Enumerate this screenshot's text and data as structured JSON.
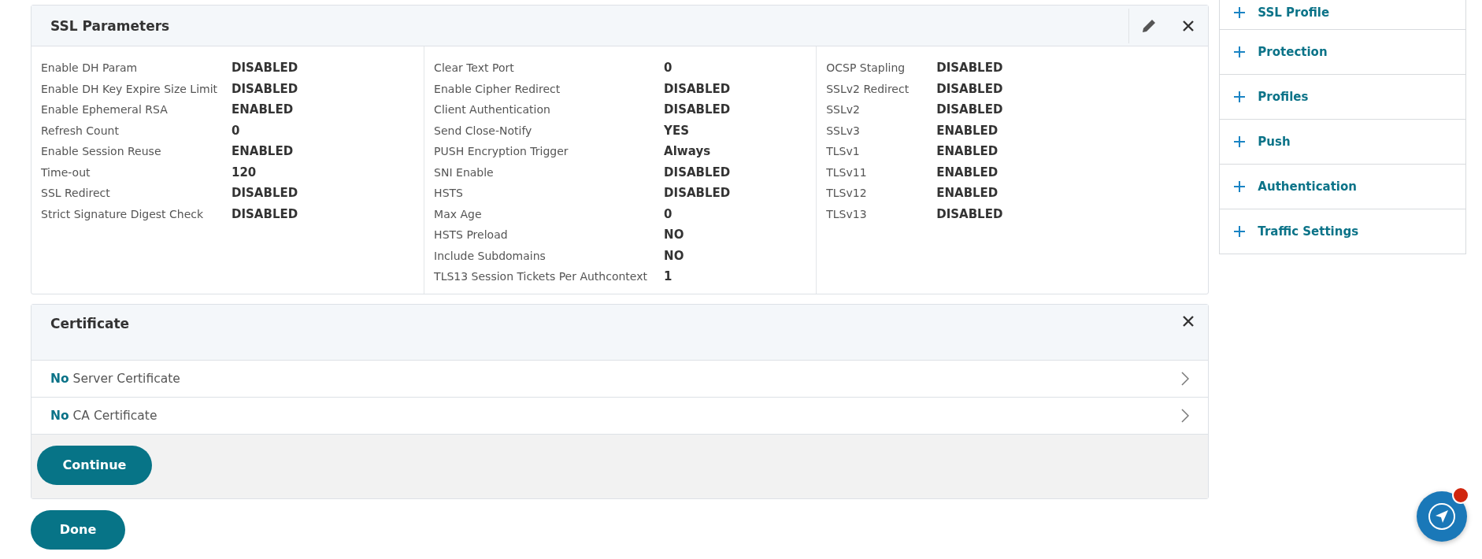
{
  "ssl_parameters": {
    "title": "SSL Parameters",
    "columns": [
      {
        "rows": [
          {
            "label": "Enable DH Param",
            "value": "DISABLED"
          },
          {
            "label": "Enable DH Key Expire Size Limit",
            "value": "DISABLED"
          },
          {
            "label": "Enable Ephemeral RSA",
            "value": "ENABLED"
          },
          {
            "label": "Refresh Count",
            "value": "0"
          },
          {
            "label": "Enable Session Reuse",
            "value": "ENABLED"
          },
          {
            "label": "Time-out",
            "value": "120"
          },
          {
            "label": "SSL Redirect",
            "value": "DISABLED"
          },
          {
            "label": "Strict Signature Digest Check",
            "value": "DISABLED"
          }
        ]
      },
      {
        "rows": [
          {
            "label": "Clear Text Port",
            "value": "0"
          },
          {
            "label": "Enable Cipher Redirect",
            "value": "DISABLED"
          },
          {
            "label": "Client Authentication",
            "value": "DISABLED"
          },
          {
            "label": "Send Close-Notify",
            "value": "YES"
          },
          {
            "label": "PUSH Encryption Trigger",
            "value": "Always"
          },
          {
            "label": "SNI Enable",
            "value": "DISABLED"
          },
          {
            "label": "HSTS",
            "value": "DISABLED"
          },
          {
            "label": "Max Age",
            "value": "0"
          },
          {
            "label": "HSTS Preload",
            "value": "NO"
          },
          {
            "label": "Include Subdomains",
            "value": "NO"
          },
          {
            "label": "TLS13 Session Tickets Per Authcontext",
            "value": "1"
          }
        ]
      },
      {
        "rows": [
          {
            "label": "OCSP Stapling",
            "value": "DISABLED"
          },
          {
            "label": "SSLv2 Redirect",
            "value": "DISABLED"
          },
          {
            "label": "SSLv2",
            "value": "DISABLED"
          },
          {
            "label": "SSLv3",
            "value": "ENABLED"
          },
          {
            "label": "TLSv1",
            "value": "ENABLED"
          },
          {
            "label": "TLSv11",
            "value": "ENABLED"
          },
          {
            "label": "TLSv12",
            "value": "ENABLED"
          },
          {
            "label": "TLSv13",
            "value": "DISABLED"
          }
        ]
      }
    ]
  },
  "certificate": {
    "title": "Certificate",
    "items": [
      {
        "text": "**No** Server Certificate"
      },
      {
        "text": "**No** CA Certificate"
      }
    ],
    "continue_button": "Continue"
  },
  "done_button": "Done",
  "sidebar": {
    "items": [
      "SSL Profile",
      "Protection",
      "Profiles",
      "Push",
      "Authentication",
      "Traffic Settings"
    ]
  }
}
